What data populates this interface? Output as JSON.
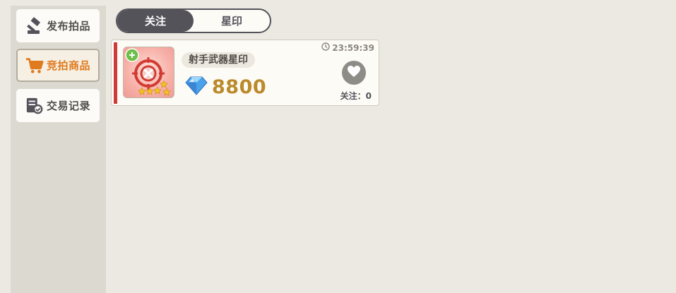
{
  "sidebar": {
    "items": [
      {
        "label": "发布拍品",
        "icon": "gavel-icon",
        "active": false
      },
      {
        "label": "竞拍商品",
        "icon": "cart-icon",
        "active": true
      },
      {
        "label": "交易记录",
        "icon": "records-icon",
        "active": false
      }
    ]
  },
  "tabs": [
    {
      "label": "关注",
      "active": true
    },
    {
      "label": "星印",
      "active": false
    }
  ],
  "listing": {
    "name": "射手武器星印",
    "price": "8800",
    "timer": "23:59:39",
    "follow_label": "关注：",
    "follow_count": "0",
    "accent_color": "#cf3a3a",
    "price_color": "#bb8a2b"
  }
}
